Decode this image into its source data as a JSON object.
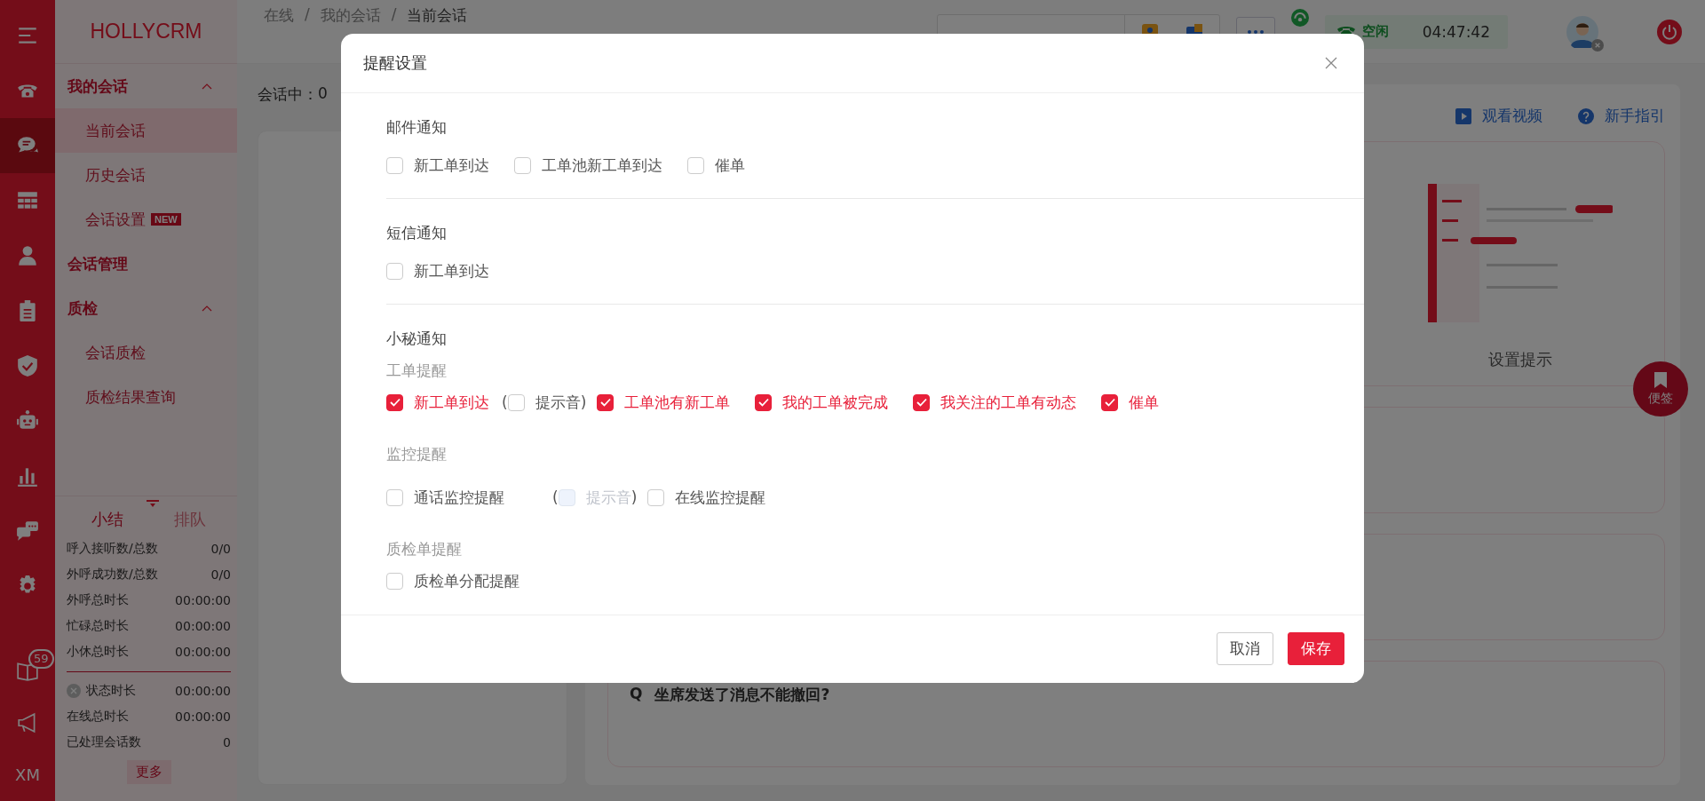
{
  "rail": {
    "items": [
      {
        "kind": "menu",
        "selected": false
      },
      {
        "kind": "phone",
        "selected": false
      },
      {
        "kind": "chat",
        "selected": true
      },
      {
        "kind": "grid",
        "selected": false
      },
      {
        "kind": "person",
        "selected": false
      },
      {
        "kind": "clipboard",
        "selected": false
      },
      {
        "kind": "shield",
        "selected": false
      },
      {
        "kind": "robot",
        "selected": false
      },
      {
        "kind": "chart",
        "selected": false
      },
      {
        "kind": "comments",
        "selected": false
      },
      {
        "kind": "gear",
        "selected": false
      }
    ],
    "bottom_items": [
      {
        "kind": "book",
        "selected": false,
        "badge": "59"
      },
      {
        "kind": "megaphone",
        "selected": false
      },
      {
        "kind": "text",
        "selected": false,
        "label": "XM"
      }
    ]
  },
  "sidebar": {
    "logo": "HOLLYCRM",
    "menu": [
      {
        "label": "我的会话",
        "expanded": true,
        "children": [
          {
            "label": "当前会话",
            "selected": true
          },
          {
            "label": "历史会话",
            "selected": false
          },
          {
            "label": "会话设置",
            "selected": false,
            "badge": "NEW"
          }
        ]
      },
      {
        "label": "会话管理"
      },
      {
        "label": "质检",
        "expanded": true,
        "children": [
          {
            "label": "会话质检",
            "selected": false
          },
          {
            "label": "质检结果查询",
            "selected": false
          }
        ]
      }
    ],
    "summary": {
      "tabs": [
        {
          "label": "小结",
          "selected": true
        },
        {
          "label": "排队",
          "selected": false
        }
      ],
      "stats": [
        {
          "label": "呼入接听数/总数",
          "value": "0/0"
        },
        {
          "label": "外呼成功数/总数",
          "value": "0/0"
        },
        {
          "label": "外呼总时长",
          "value": "00:00:00"
        },
        {
          "label": "忙碌总时长",
          "value": "00:00:00"
        },
        {
          "label": "小休总时长",
          "value": "00:00:00"
        }
      ],
      "status_stats": [
        {
          "label": "状态时长",
          "value": "00:00:00",
          "kind": "status"
        },
        {
          "label": "在线总时长",
          "value": "00:00:00",
          "kind": "plain"
        },
        {
          "label": "已处理会话数",
          "value": "0",
          "kind": "plain"
        }
      ],
      "more_button": "更多"
    }
  },
  "header": {
    "breadcrumb": [
      "在线",
      "我的会话",
      "当前会话"
    ],
    "separator": "/",
    "status": {
      "label": "空闲",
      "time": "04:47:42"
    }
  },
  "main": {
    "session_count": {
      "label": "会话中：",
      "value": "0"
    },
    "help_links": [
      {
        "label": "观看视频",
        "kind": "video"
      },
      {
        "label": "新手指引",
        "kind": "guide"
      }
    ],
    "tip_caption": "设置提示",
    "faq": {
      "marker": "Q",
      "question": "坐席发送了消息不能撤回?"
    },
    "note_button": "便签"
  },
  "dialog": {
    "title": "提醒设置",
    "sections": [
      {
        "title": "邮件通知",
        "groups": [
          {
            "options": [
              {
                "label": "新工单到达",
                "checked": false
              },
              {
                "label": "工单池新工单到达",
                "checked": false
              },
              {
                "label": "催单",
                "checked": false
              }
            ]
          }
        ]
      },
      {
        "title": "短信通知",
        "groups": [
          {
            "options": [
              {
                "label": "新工单到达",
                "checked": false
              }
            ]
          }
        ]
      },
      {
        "title": "小秘通知",
        "groups": [
          {
            "subtitle": "工单提醒",
            "options": [
              {
                "label": "新工单到达",
                "checked": true,
                "sound": {
                  "open": "(",
                  "label": "提示音",
                  "checked": false,
                  "disabled": false,
                  "close": ")"
                }
              },
              {
                "label": "工单池有新工单",
                "checked": true
              },
              {
                "label": "我的工单被完成",
                "checked": true
              },
              {
                "label": "我关注的工单有动态",
                "checked": true
              },
              {
                "label": "催单",
                "checked": true
              }
            ]
          },
          {
            "subtitle": "监控提醒",
            "options": [
              {
                "label": "通话监控提醒",
                "checked": false,
                "sound": {
                  "open": "(",
                  "label": "提示音",
                  "checked": false,
                  "disabled": true,
                  "close": ")"
                }
              },
              {
                "label": "在线监控提醒",
                "checked": false
              }
            ]
          },
          {
            "subtitle": "质检单提醒",
            "options": [
              {
                "label": "质检单分配提醒",
                "checked": false
              }
            ]
          }
        ]
      }
    ],
    "buttons": [
      {
        "label": "取消",
        "kind": "secondary"
      },
      {
        "label": "保存",
        "kind": "primary"
      }
    ]
  }
}
